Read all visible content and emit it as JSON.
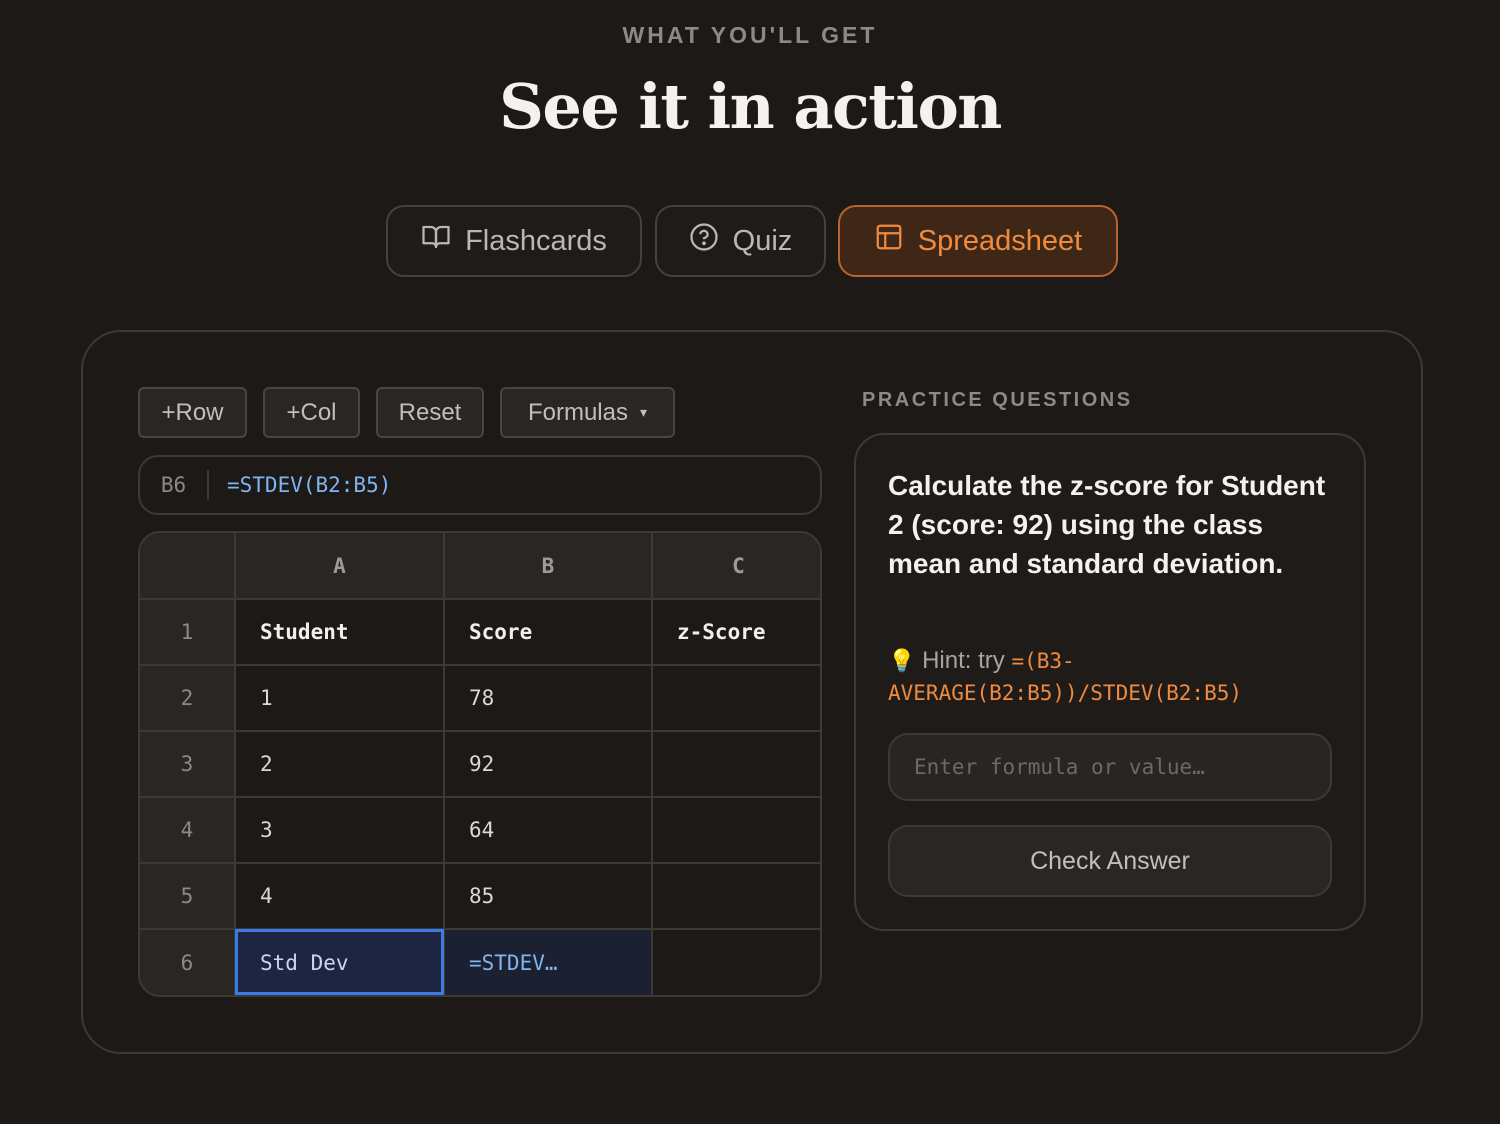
{
  "header": {
    "eyebrow": "WHAT YOU'LL GET",
    "title": "See it in action"
  },
  "tabs": [
    {
      "label": "Flashcards",
      "icon": "book-open-icon",
      "active": false
    },
    {
      "label": "Quiz",
      "icon": "help-circle-icon",
      "active": false
    },
    {
      "label": "Spreadsheet",
      "icon": "table-icon",
      "active": true
    }
  ],
  "colors": {
    "background": "#1d1917",
    "accent": "#f28a3e",
    "selection": "#3b7be8",
    "formula_text": "#7fb5f0"
  },
  "toolbar": {
    "add_row": "+Row",
    "add_col": "+Col",
    "reset": "Reset",
    "formulas": "Formulas",
    "formulas_caret": "▾"
  },
  "formula_bar": {
    "cell_ref": "B6",
    "expression": "=STDEV(B2:B5)"
  },
  "sheet": {
    "columns": [
      "A",
      "B",
      "C"
    ],
    "rows": [
      {
        "num": "1",
        "cells": [
          "Student",
          "Score",
          "z-Score"
        ]
      },
      {
        "num": "2",
        "cells": [
          "1",
          "78",
          ""
        ]
      },
      {
        "num": "3",
        "cells": [
          "2",
          "92",
          ""
        ]
      },
      {
        "num": "4",
        "cells": [
          "3",
          "64",
          ""
        ]
      },
      {
        "num": "5",
        "cells": [
          "4",
          "85",
          ""
        ]
      },
      {
        "num": "6",
        "cells": [
          "Std Dev",
          "=STDEV…",
          ""
        ]
      }
    ]
  },
  "practice": {
    "label": "PRACTICE QUESTIONS",
    "question": "Calculate the z-score for Student 2 (score: 92) using the class mean and standard deviation.",
    "hint_prefix": "Hint: try",
    "hint_formula": "=(B3-AVERAGE(B2:B5))/STDEV(B2:B5)",
    "input_placeholder": "Enter formula or value…",
    "check_button": "Check Answer"
  }
}
